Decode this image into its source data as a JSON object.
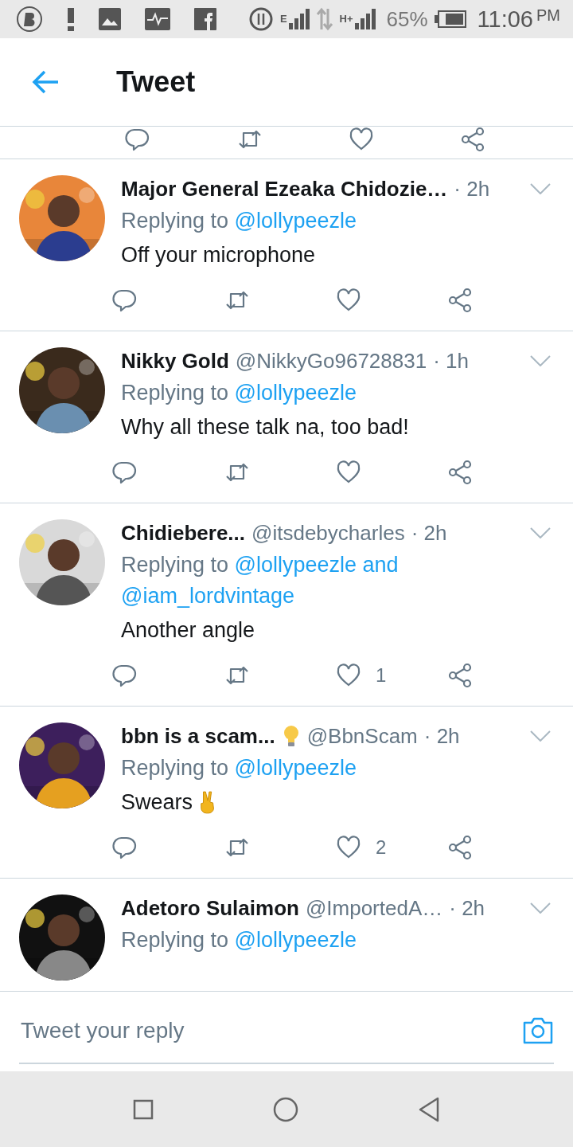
{
  "status_bar": {
    "network_1": "E",
    "network_2": "H+",
    "battery": "65%",
    "time": "11:06",
    "meridiem": "PM"
  },
  "header": {
    "title": "Tweet"
  },
  "tweets": [
    {
      "name": "Major General Ezeaka Chidozie…",
      "time": "· 2h",
      "replying_label": "Replying to",
      "mentions": [
        "@lollypeezle"
      ],
      "text": "Off your microphone"
    },
    {
      "name": "Nikky Gold",
      "handle": "@NikkyGo96728831",
      "time": "· 1h",
      "replying_label": "Replying to",
      "mentions": [
        "@lollypeezle"
      ],
      "text": "Why all these talk na, too bad!"
    },
    {
      "name": "Chidiebere...",
      "handle": "@itsdebycharles",
      "time": "· 2h",
      "replying_label": "Replying to",
      "mentions": [
        "@lollypeezle",
        "@iam_lordvintage"
      ],
      "connector": "and",
      "text": "Another angle",
      "likes": "1"
    },
    {
      "name": "bbn is a scam...",
      "name_emoji": true,
      "handle": "@BbnScam",
      "time": "· 2h",
      "replying_label": "Replying to",
      "mentions": [
        "@lollypeezle"
      ],
      "text": "Swears",
      "text_emoji": true,
      "likes": "2"
    },
    {
      "name": "Adetoro Sulaimon",
      "handle": "@ImportedA…",
      "time": "· 2h",
      "replying_label": "Replying to",
      "mentions": [
        "@lollypeezle"
      ]
    }
  ],
  "reply_bar": {
    "placeholder": "Tweet your reply"
  }
}
